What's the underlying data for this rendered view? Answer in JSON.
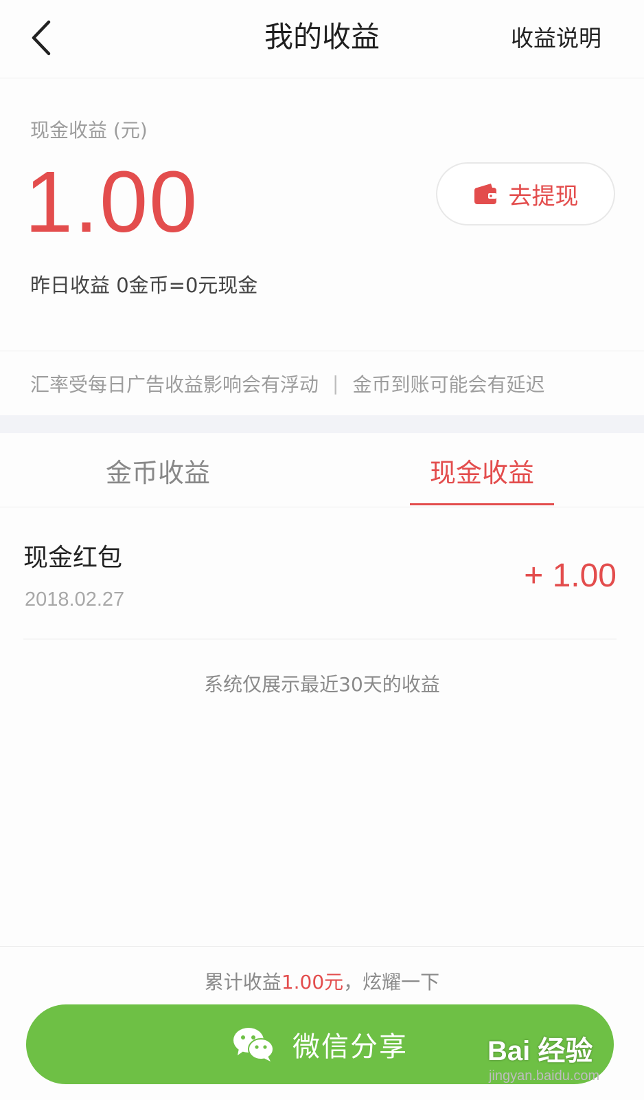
{
  "nav": {
    "title": "我的收益",
    "right_link": "收益说明"
  },
  "summary": {
    "label": "现金收益 (元)",
    "amount": "1.00",
    "withdraw_label": "去提现",
    "yesterday": "昨日收益 0金币=0元现金"
  },
  "notice": {
    "left": "汇率受每日广告收益影响会有浮动",
    "separator": "|",
    "right": "金币到账可能会有延迟"
  },
  "tabs": [
    {
      "label": "金币收益",
      "active": false
    },
    {
      "label": "现金收益",
      "active": true
    }
  ],
  "records": [
    {
      "title": "现金红包",
      "date": "2018.02.27",
      "amount": "+ 1.00"
    }
  ],
  "footnote": "系统仅展示最近30天的收益",
  "bottom": {
    "total_prefix": "累计收益",
    "total_value": "1.00元",
    "total_suffix": "，炫耀一下",
    "share_label": "微信分享"
  },
  "watermark": {
    "logo": "Bai 经验",
    "sub": "jingyan.baidu.com"
  },
  "colors": {
    "accent_red": "#e34d4d",
    "share_green": "#6ec045",
    "muted_text": "#9d9d9d"
  },
  "icons": {
    "back": "chevron-left-icon",
    "withdraw": "wallet-icon",
    "share": "wechat-icon"
  }
}
